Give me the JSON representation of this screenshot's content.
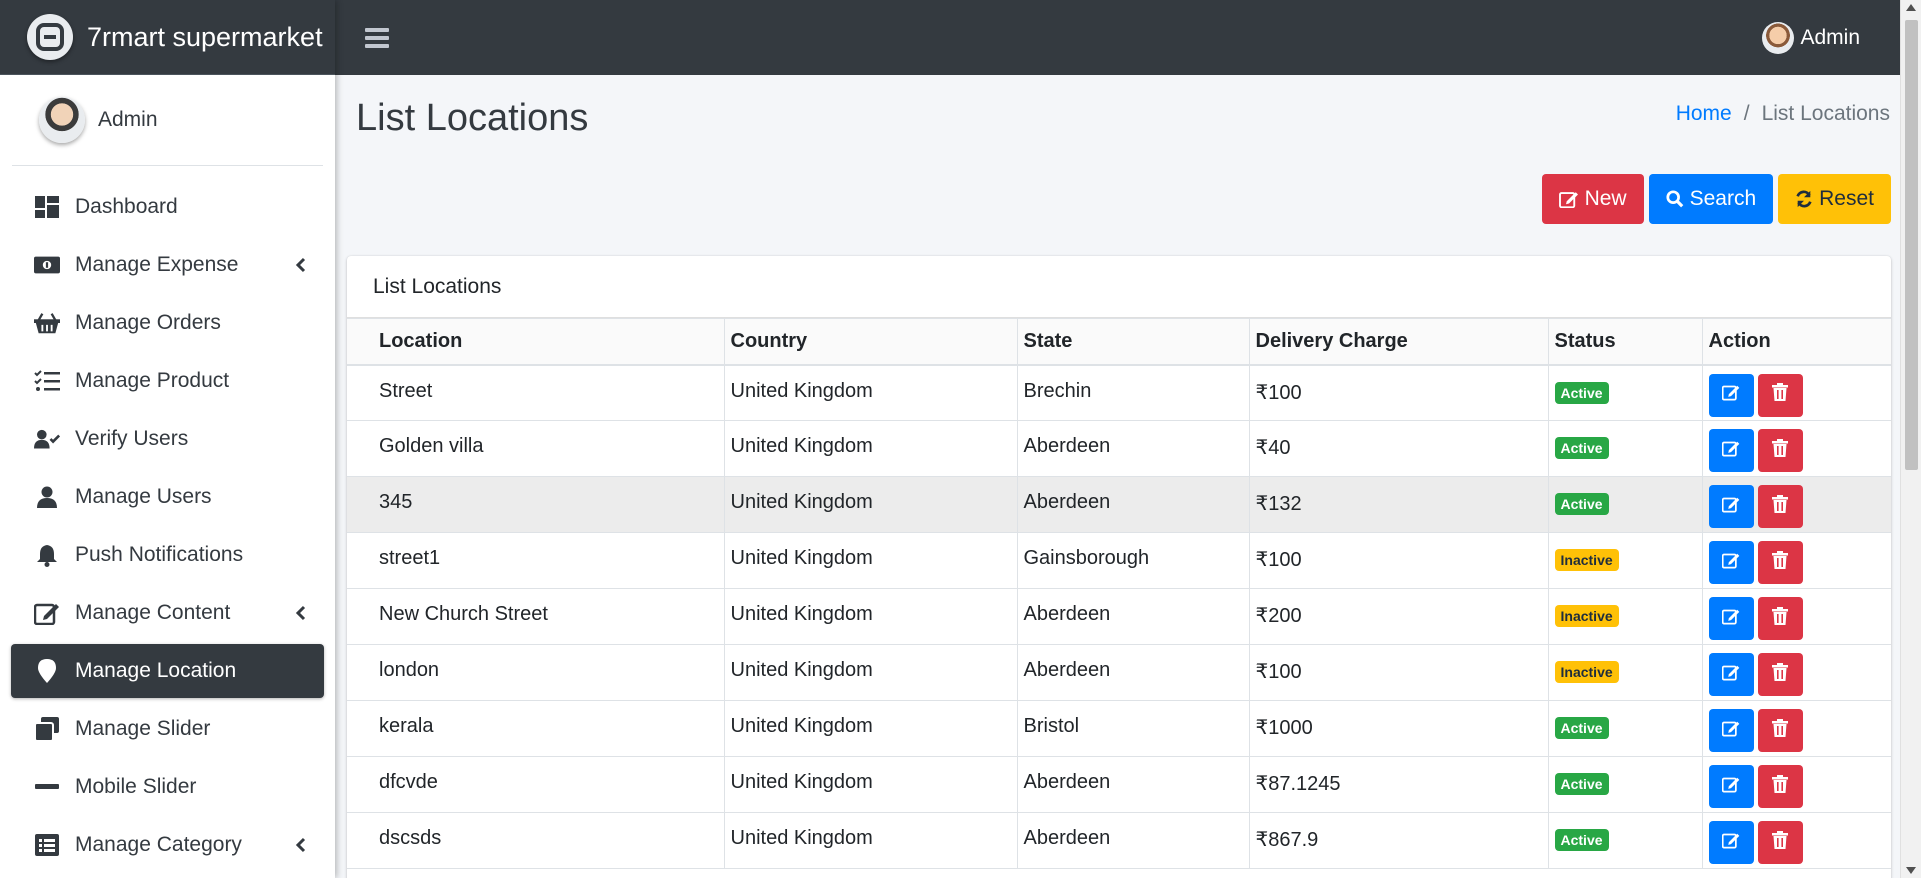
{
  "brand": {
    "name": "7rmart supermarket"
  },
  "user": {
    "name": "Admin"
  },
  "topbar": {
    "user_label": "Admin"
  },
  "sidebar": {
    "items": [
      {
        "label": "Dashboard",
        "icon": "dashboard-icon"
      },
      {
        "label": "Manage Expense",
        "icon": "money-icon",
        "chevron": true
      },
      {
        "label": "Manage Orders",
        "icon": "basket-icon"
      },
      {
        "label": "Manage Product",
        "icon": "tasks-icon"
      },
      {
        "label": "Verify Users",
        "icon": "user-check-icon"
      },
      {
        "label": "Manage Users",
        "icon": "user-icon"
      },
      {
        "label": "Push Notifications",
        "icon": "bell-icon"
      },
      {
        "label": "Manage Content",
        "icon": "edit-icon",
        "chevron": true
      },
      {
        "label": "Manage Location",
        "icon": "map-marker-icon",
        "active": true
      },
      {
        "label": "Manage Slider",
        "icon": "window-restore-icon"
      },
      {
        "label": "Mobile Slider",
        "icon": "minus-icon"
      },
      {
        "label": "Manage Category",
        "icon": "list-alt-icon",
        "chevron": true
      }
    ]
  },
  "page": {
    "title": "List Locations"
  },
  "breadcrumb": {
    "home": "Home",
    "separator": "/",
    "current": "List Locations"
  },
  "actions": {
    "new": "New",
    "search": "Search",
    "reset": "Reset"
  },
  "card": {
    "title": "List Locations"
  },
  "table": {
    "headers": {
      "location": "Location",
      "country": "Country",
      "state": "State",
      "delivery": "Delivery Charge",
      "status": "Status",
      "action": "Action"
    },
    "rows": [
      {
        "location": "Street",
        "country": "United Kingdom",
        "state": "Brechin",
        "delivery": "₹100",
        "status": "Active"
      },
      {
        "location": "Golden villa",
        "country": "United Kingdom",
        "state": "Aberdeen",
        "delivery": "₹40",
        "status": "Active"
      },
      {
        "location": "345",
        "country": "United Kingdom",
        "state": "Aberdeen",
        "delivery": "₹132",
        "status": "Active"
      },
      {
        "location": "street1",
        "country": "United Kingdom",
        "state": "Gainsborough",
        "delivery": "₹100",
        "status": "Inactive"
      },
      {
        "location": "New Church Street",
        "country": "United Kingdom",
        "state": "Aberdeen",
        "delivery": "₹200",
        "status": "Inactive"
      },
      {
        "location": "london",
        "country": "United Kingdom",
        "state": "Aberdeen",
        "delivery": "₹100",
        "status": "Inactive"
      },
      {
        "location": "kerala",
        "country": "United Kingdom",
        "state": "Bristol",
        "delivery": "₹1000",
        "status": "Active"
      },
      {
        "location": "dfcvde",
        "country": "United Kingdom",
        "state": "Aberdeen",
        "delivery": "₹87.1245",
        "status": "Active"
      },
      {
        "location": "dscsds",
        "country": "United Kingdom",
        "state": "Aberdeen",
        "delivery": "₹867.9",
        "status": "Active"
      }
    ]
  },
  "colors": {
    "dark": "#343a40",
    "primary": "#007bff",
    "danger": "#dc3545",
    "warning": "#ffc107",
    "success": "#28a745"
  }
}
